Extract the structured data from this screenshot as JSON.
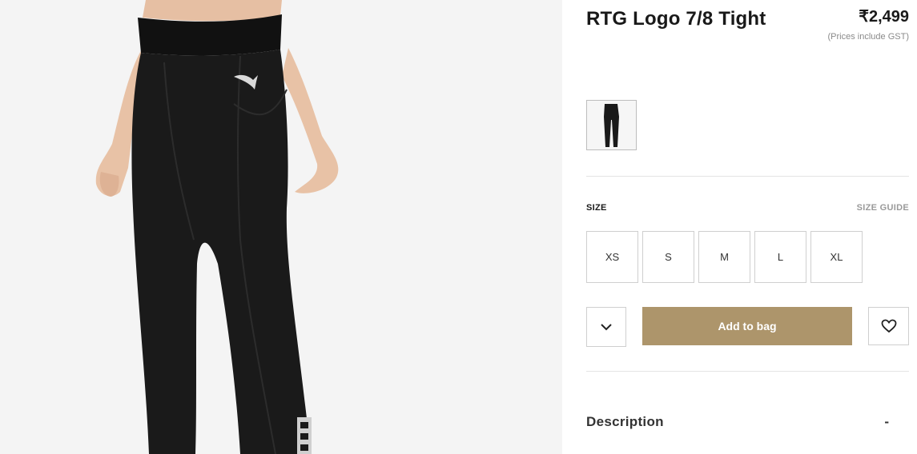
{
  "product": {
    "title": "RTG Logo 7/8 Tight",
    "price": "₹2,499",
    "price_note": "(Prices include GST)"
  },
  "image": {
    "alt": "Black leggings with puma logo"
  },
  "size": {
    "heading": "SIZE",
    "guide_label": "SIZE GUIDE",
    "options": [
      "XS",
      "S",
      "M",
      "L",
      "XL"
    ]
  },
  "actions": {
    "quantity_icon": "chevron-down-icon",
    "add_to_bag_label": "Add to bag",
    "wishlist_icon": "heart-icon"
  },
  "description": {
    "label": "Description",
    "toggle_symbol": "-"
  },
  "colors": {
    "accent": "#ad956b",
    "image_background": "#f4f4f4",
    "legging": "#1a1a1a"
  }
}
